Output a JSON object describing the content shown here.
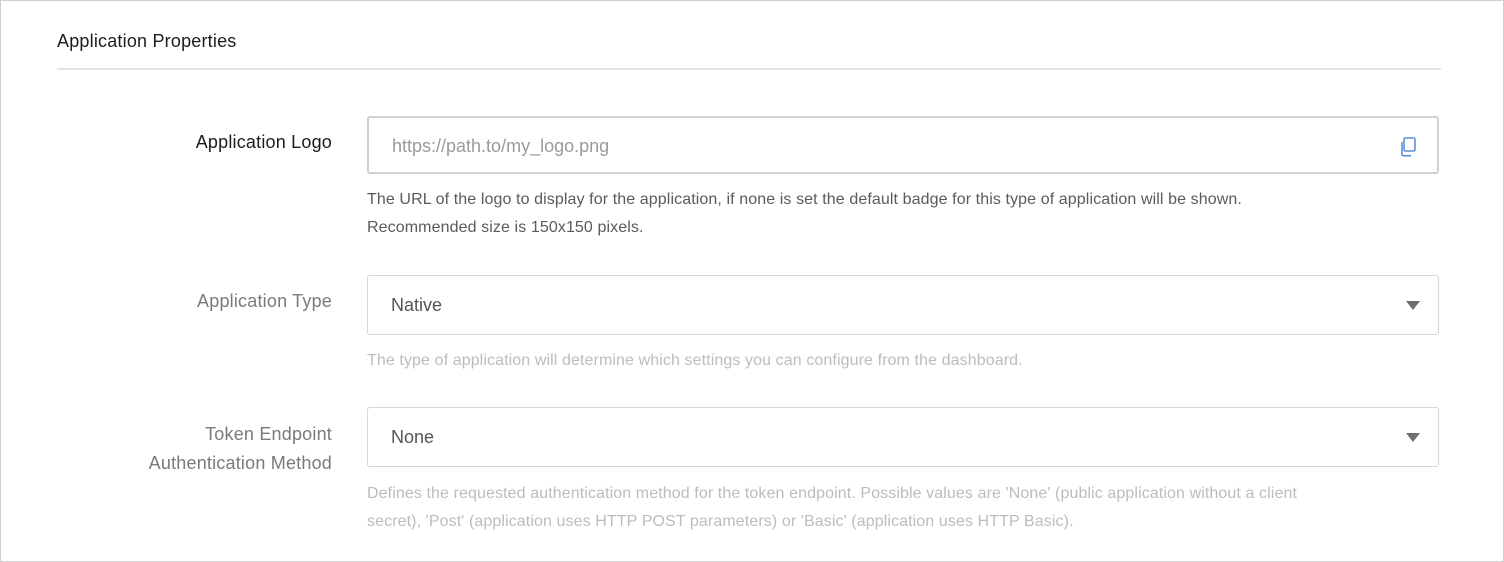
{
  "section": {
    "title": "Application Properties"
  },
  "fields": {
    "logo": {
      "label": "Application Logo",
      "placeholder": "https://path.to/my_logo.png",
      "value": "",
      "icon": "copy-icon",
      "help_line1": "The URL of the logo to display for the application, if none is set the default badge for this type of application will be shown.",
      "help_line2": "Recommended size is 150x150 pixels."
    },
    "app_type": {
      "label": "Application Type",
      "selected": "Native",
      "icon": "caret-down-icon",
      "help_line1": "The type of application will determine which settings you can configure from the dashboard."
    },
    "token_auth": {
      "label_line1": "Token Endpoint",
      "label_line2": "Authentication Method",
      "selected": "None",
      "icon": "caret-down-icon",
      "help_line1": "Defines the requested authentication method for the token endpoint. Possible values are 'None' (public application without a client",
      "help_line2": "secret), 'Post' (application uses HTTP POST parameters) or 'Basic' (application uses HTTP Basic)."
    }
  },
  "colors": {
    "active_text": "#1c1c1c",
    "muted_text": "#7a7a7a",
    "help_muted": "#bcbcbc",
    "help_active": "#5a5a5a",
    "border": "#d6d6d6"
  }
}
